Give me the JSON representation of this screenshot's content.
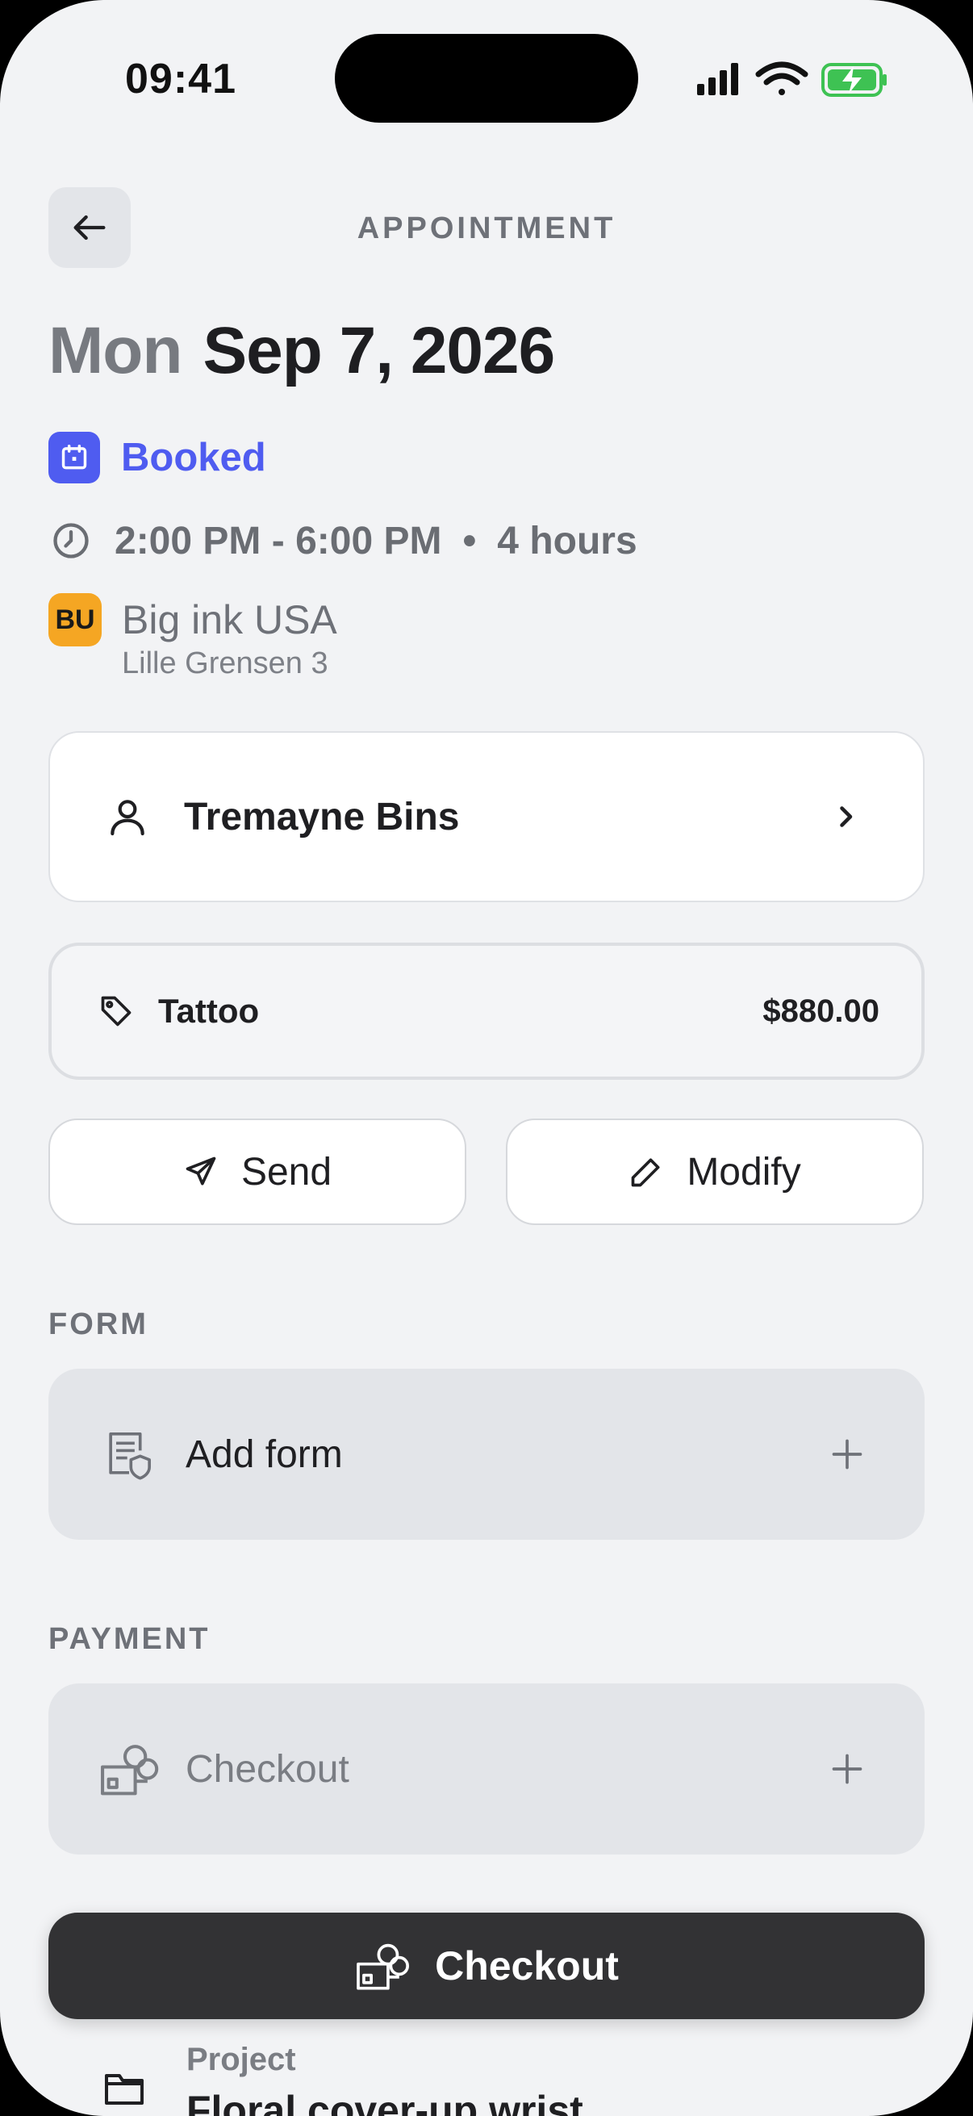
{
  "status_bar": {
    "time": "09:41"
  },
  "header": {
    "title": "APPOINTMENT"
  },
  "appointment": {
    "weekday": "Mon",
    "date": "Sep 7, 2026",
    "status": "Booked",
    "time_range": "2:00 PM - 6:00 PM",
    "separator": "•",
    "duration": "4 hours"
  },
  "studio": {
    "initials": "BU",
    "name": "Big ink USA",
    "address": "Lille Grensen 3",
    "badge_color": "#f5a623"
  },
  "client": {
    "name": "Tremayne Bins"
  },
  "service": {
    "name": "Tattoo",
    "price": "$880.00"
  },
  "actions": {
    "send_label": "Send",
    "modify_label": "Modify"
  },
  "form_section": {
    "label": "FORM",
    "add_label": "Add form"
  },
  "payment_section": {
    "label": "PAYMENT",
    "add_label": "Checkout"
  },
  "project": {
    "label": "Project",
    "value": "Floral cover-up wrist"
  },
  "checkout_button": {
    "label": "Checkout"
  },
  "colors": {
    "accent": "#4f5cf0",
    "dark_button": "#323234",
    "background": "#f2f3f5"
  }
}
